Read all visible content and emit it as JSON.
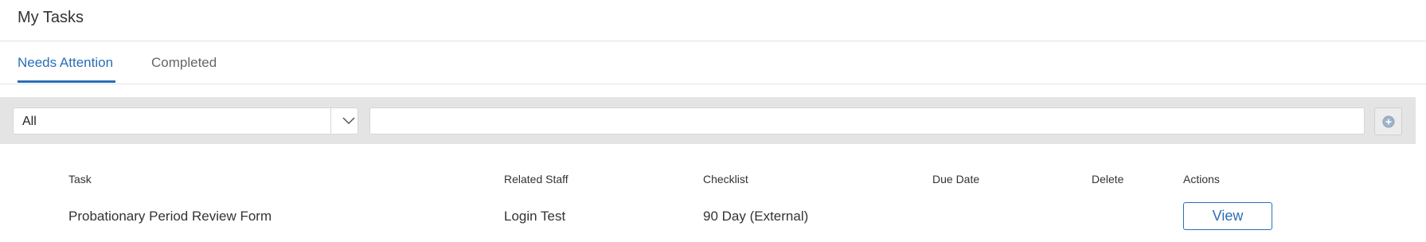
{
  "header": {
    "title": "My Tasks"
  },
  "tabs": [
    {
      "label": "Needs Attention",
      "active": true
    },
    {
      "label": "Completed",
      "active": false
    }
  ],
  "filter": {
    "selected": "All",
    "search_value": "",
    "chevron_icon": "chevron-down-icon",
    "add_icon": "plus-circle-icon"
  },
  "table": {
    "columns": [
      "Task",
      "Related Staff",
      "Checklist",
      "Due Date",
      "Delete",
      "Actions"
    ],
    "rows": [
      {
        "task": "Probationary Period Review Form",
        "related_staff": "Login Test",
        "checklist": "90 Day (External)",
        "due_date": "",
        "delete": "",
        "action_label": "View"
      }
    ]
  },
  "colors": {
    "accent": "#2a6eb5",
    "filter_bar": "#e4e4e4",
    "border": "#e2e2e2"
  }
}
